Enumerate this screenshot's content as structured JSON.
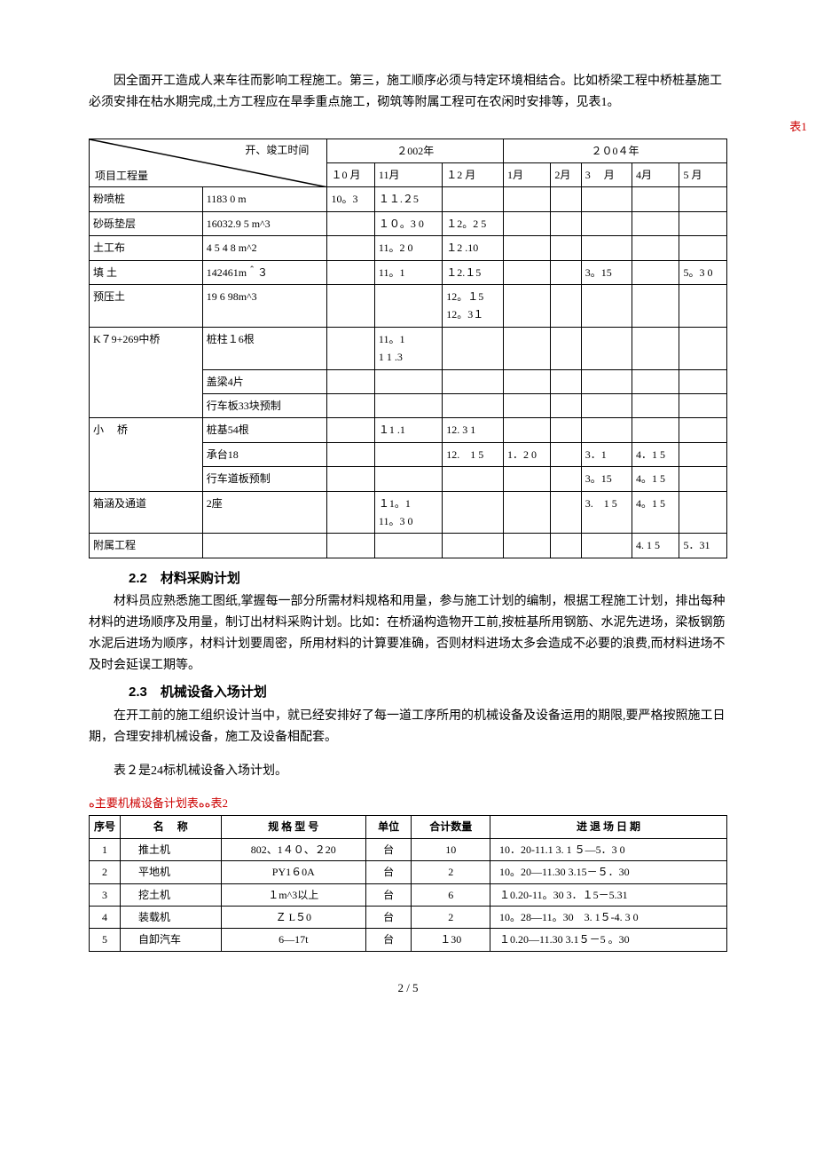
{
  "intro": "因全面开工造成人来车往而影响工程施工。第三，施工顺序必须与特定环境相结合。比如桥梁工程中桥桩基施工必须安排在枯水期完成,土方工程应在旱季重点施工，砌筑等附属工程可在农闲时安排等，见表1。",
  "table1_label": "表1",
  "t1_diag_top": "开、竣工时间",
  "t1_diag_bot": "项目工程量",
  "t1_years": {
    "y2002": "２002年",
    "y2004": "２０0４年"
  },
  "t1_months": [
    "１0 月",
    "11月",
    "１2  月",
    "1月",
    "2月",
    "3　 月",
    "4月",
    "5 月"
  ],
  "t1_rows": [
    {
      "name": "粉喷桩",
      "qty": "1183 0 m",
      "cells": [
        "10。3",
        "１１.２5",
        "",
        "",
        "",
        "",
        "",
        ""
      ]
    },
    {
      "name": "砂砾垫层",
      "qty": "16032.9 5 m^3",
      "cells": [
        "",
        "１０。3 0",
        "１2。2 5",
        "",
        "",
        "",
        "",
        ""
      ]
    },
    {
      "name": "土工布",
      "qty": "4 5 4 8 m^2",
      "cells": [
        "",
        "11。2 0",
        "１2 .10",
        "",
        "",
        "",
        "",
        ""
      ]
    },
    {
      "name": "填  土",
      "qty": "142461m＾３",
      "cells": [
        "",
        "11。1",
        "１2.１5",
        "",
        "",
        "3。15",
        "",
        "5。3 0"
      ]
    },
    {
      "name": "预压土",
      "qty": "19 6 98m^3",
      "cells": [
        "",
        "",
        "12。１5\n12。3１",
        "",
        "",
        "",
        "",
        ""
      ]
    },
    {
      "name": "K７9+269中桥",
      "qty": "桩柱１6根",
      "cells": [
        "",
        "11。1\n1 1 .3",
        "",
        "",
        "",
        "",
        "",
        ""
      ]
    },
    {
      "name": "",
      "qty": "盖梁4片",
      "cells": [
        "",
        "",
        "",
        "",
        "",
        "",
        "",
        ""
      ]
    },
    {
      "name": "",
      "qty": "行车板33块预制",
      "cells": [
        "",
        "",
        "",
        "",
        "",
        "",
        "",
        ""
      ]
    },
    {
      "name": "小　 桥",
      "qty": "桩基54根",
      "cells": [
        "",
        "１1 .1",
        "12. 3 1",
        "",
        "",
        "",
        "",
        ""
      ]
    },
    {
      "name": "",
      "qty": "承台18",
      "cells": [
        "",
        "",
        "12.　1 5",
        "1．2 0",
        "",
        "3．1",
        "4．1 5",
        ""
      ]
    },
    {
      "name": "",
      "qty": "行车道板预制",
      "cells": [
        "",
        "",
        "",
        "",
        "",
        "3。15",
        "4。1 5",
        ""
      ]
    },
    {
      "name": "箱涵及通道",
      "qty": "2座",
      "cells": [
        "",
        "１1。1\n11。3 0",
        "",
        "",
        "",
        "3.　1 5",
        "4。1 5",
        ""
      ]
    },
    {
      "name": "附属工程",
      "qty": "",
      "cells": [
        "",
        "",
        "",
        "",
        "",
        "",
        "4. 1 5",
        "5．31"
      ]
    }
  ],
  "h22": "2.2　材料采购计划",
  "p22": "材料员应熟悉施工图纸,掌握每一部分所需材料规格和用量，参与施工计划的编制，根据工程施工计划，排出每种材料的进场顺序及用量，制订出材料采购计划。比如：在桥涵构造物开工前,按桩基所用钢筋、水泥先进场，梁板钢筋水泥后进场为顺序，材料计划要周密，所用材料的计算要准确，否则材料进场太多会造成不必要的浪费,而材料进场不及时会延误工期等。",
  "h23": "2.3　机械设备入场计划",
  "p23a": "在开工前的施工组织设计当中，就已经安排好了每一道工序所用的机械设备及设备运用的期限,要严格按照施工日期，合理安排机械设备，施工及设备相配套。",
  "p23b": "表２是24标机械设备入场计划。",
  "t2_caption": "ﻩ主要机械设备计划表ﻩﻩ表2",
  "t2_headers": [
    "序号",
    "名　 称",
    "规 格 型 号",
    "单位",
    "合计数量",
    "进 退 场 日 期"
  ],
  "t2_rows": [
    [
      "1",
      "推土机",
      "802、1４０、２20",
      "台",
      "10",
      "10．20-11.1 3. 1 ５—5．3 0"
    ],
    [
      "2",
      "平地机",
      "PY1６0A",
      "台",
      "2",
      "10。20—11.30 3.15－５．30"
    ],
    [
      "3",
      "挖土机",
      "１m^3以上",
      "台",
      "6",
      "１0.20-11。30 3．１5－5.31"
    ],
    [
      "4",
      "装载机",
      "Ｚ L５0",
      "台",
      "2",
      "10。28—11。30　3. 1５-4. 3 0"
    ],
    [
      "5",
      "自卸汽车",
      "6—17t",
      "台",
      "１30",
      "１0.20—11.30 3.1５－5 。30"
    ]
  ],
  "page_num": "2 / 5"
}
